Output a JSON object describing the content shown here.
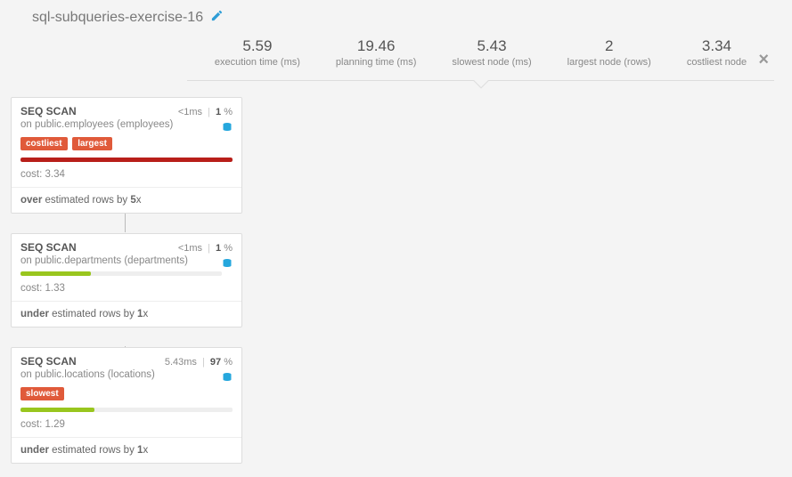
{
  "title": "sql-subqueries-exercise-16",
  "stats": [
    {
      "value": "5.59",
      "label": "execution time (ms)"
    },
    {
      "value": "19.46",
      "label": "planning time (ms)"
    },
    {
      "value": "5.43",
      "label": "slowest node (ms)"
    },
    {
      "value": "2",
      "label": "largest node (rows)"
    },
    {
      "value": "3.34",
      "label": "costliest node"
    }
  ],
  "nodes": [
    {
      "op": "SEQ SCAN",
      "time_html": "<1",
      "time_unit": "ms",
      "pct": "1",
      "target": "on public.employees (employees)",
      "tags": [
        "costliest",
        "largest"
      ],
      "bar_color": "bar-red",
      "bar_width": "100%",
      "cost_label": "cost:",
      "cost": "3.34",
      "est_dir": "over",
      "est_text": " estimated rows by ",
      "est_factor": "5"
    },
    {
      "op": "SEQ SCAN",
      "time_html": "<1",
      "time_unit": "ms",
      "pct": "1",
      "target": "on public.departments (departments)",
      "tags": [],
      "bar_color": "bar-green",
      "bar_width": "35%",
      "cost_label": "cost:",
      "cost": "1.33",
      "est_dir": "under",
      "est_text": " estimated rows by ",
      "est_factor": "1"
    },
    {
      "op": "SEQ SCAN",
      "time_html": "5.43",
      "time_unit": "ms",
      "pct": "97",
      "target": "on public.locations (locations)",
      "tags": [
        "slowest"
      ],
      "bar_color": "bar-green",
      "bar_width": "35%",
      "cost_label": "cost:",
      "cost": "1.29",
      "est_dir": "under",
      "est_text": " estimated rows by ",
      "est_factor": "1"
    }
  ]
}
